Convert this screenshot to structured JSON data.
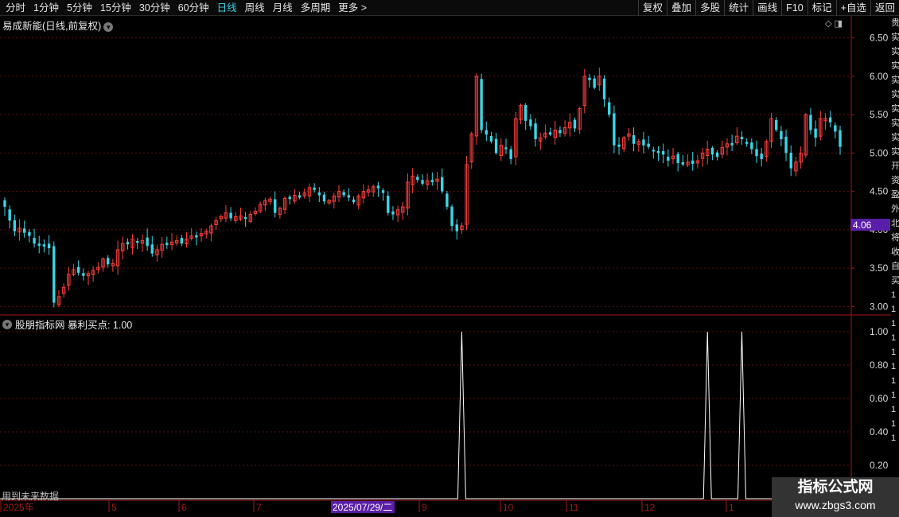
{
  "toolbar": {
    "periods": [
      {
        "label": "分时",
        "active": false
      },
      {
        "label": "1分钟",
        "active": false
      },
      {
        "label": "5分钟",
        "active": false
      },
      {
        "label": "15分钟",
        "active": false
      },
      {
        "label": "30分钟",
        "active": false
      },
      {
        "label": "60分钟",
        "active": false
      },
      {
        "label": "日线",
        "active": true
      },
      {
        "label": "周线",
        "active": false
      },
      {
        "label": "月线",
        "active": false
      },
      {
        "label": "多周期",
        "active": false
      },
      {
        "label": "更多",
        "active": false
      }
    ],
    "more_arrow": ">",
    "buttons": [
      "复权",
      "叠加",
      "多股",
      "统计",
      "画线",
      "F10",
      "标记",
      "+自选",
      "返回"
    ]
  },
  "stock": {
    "title": "易成新能(日线,前复权)",
    "dropdown_icon": "chevron-down-icon"
  },
  "price_axis": {
    "ticks": [
      "6.50",
      "6.00",
      "5.50",
      "5.00",
      "4.50",
      "4.00",
      "3.50",
      "3.00"
    ],
    "current_price": "4.06"
  },
  "indicator": {
    "title": "股朋指标网 暴利买点: 1.00",
    "axis_ticks": [
      "1.00",
      "0.80",
      "0.60",
      "0.40",
      "0.20"
    ],
    "signal_index": [
      93,
      143,
      150
    ],
    "future_data_label": "用到未来数据"
  },
  "date_axis": {
    "labels": [
      "2025年",
      "5",
      "6",
      "7",
      "2025/07/29/二",
      "9",
      "10",
      "11",
      "12",
      "1"
    ],
    "highlight_label": "2025/07/29/二"
  },
  "right_strip": [
    "贵",
    "实",
    "实",
    "实",
    "实",
    "实",
    "实",
    "实",
    "实",
    "实",
    "开",
    "资",
    "盈",
    "外",
    "北",
    "将",
    "收",
    "自",
    "买",
    "1",
    "1",
    "1",
    "1",
    "1",
    "1",
    "1",
    "1",
    "1",
    "1",
    "1"
  ],
  "watermark": {
    "line1": "指标公式网",
    "line2": "www.zbgs3.com"
  },
  "colors": {
    "up": "#ff3e3e",
    "down": "#3ad6e6",
    "grid": "#5a0f0f",
    "axis": "#a01818",
    "price_label_bg": "#5a1ea8",
    "date_label_bg": "#5a1ea8",
    "toolbar_active": "#3ad0e8",
    "signal_line": "#ffffff"
  },
  "chart_data": {
    "type": "candlestick",
    "title": "易成新能(日线,前复权)",
    "ylim": [
      2.9,
      6.6
    ],
    "closes": [
      4.3,
      4.12,
      3.98,
      4.02,
      3.96,
      3.92,
      3.82,
      3.79,
      3.78,
      3.76,
      3.05,
      3.13,
      3.25,
      3.42,
      3.48,
      3.44,
      3.4,
      3.43,
      3.47,
      3.51,
      3.62,
      3.55,
      3.56,
      3.74,
      3.82,
      3.81,
      3.88,
      3.83,
      3.86,
      3.79,
      3.69,
      3.74,
      3.81,
      3.8,
      3.84,
      3.86,
      3.82,
      3.88,
      3.92,
      3.9,
      3.95,
      3.98,
      4.05,
      4.12,
      4.17,
      4.22,
      4.15,
      4.17,
      4.18,
      4.14,
      4.2,
      4.24,
      4.33,
      4.38,
      4.4,
      4.22,
      4.28,
      4.41,
      4.4,
      4.45,
      4.42,
      4.48,
      4.55,
      4.52,
      4.45,
      4.37,
      4.38,
      4.44,
      4.5,
      4.45,
      4.42,
      4.36,
      4.44,
      4.5,
      4.52,
      4.56,
      4.54,
      4.48,
      4.22,
      4.2,
      4.26,
      4.3,
      4.62,
      4.7,
      4.65,
      4.6,
      4.64,
      4.62,
      4.66,
      4.5,
      4.3,
      4.05,
      3.98,
      4.05,
      4.85,
      5.25,
      6.0,
      5.3,
      5.24,
      5.15,
      5.0,
      5.1,
      5.05,
      4.92,
      5.45,
      5.62,
      5.42,
      5.35,
      5.18,
      5.2,
      5.26,
      5.24,
      5.3,
      5.26,
      5.33,
      5.4,
      5.32,
      5.58,
      6.0,
      5.95,
      5.85,
      6.0,
      5.7,
      5.5,
      5.1,
      5.08,
      5.2,
      5.25,
      5.12,
      5.15,
      5.1,
      5.08,
      5.02,
      5.0,
      4.98,
      4.9,
      4.96,
      4.87,
      4.85,
      4.88,
      4.86,
      4.9,
      5.0,
      5.05,
      4.98,
      4.95,
      5.07,
      5.12,
      5.1,
      5.22,
      5.18,
      5.12,
      5.05,
      4.96,
      4.92,
      5.15,
      5.45,
      5.3,
      5.18,
      5.0,
      4.8,
      4.88,
      5.0,
      5.5,
      5.3,
      5.2,
      5.45,
      5.45,
      5.4,
      5.28,
      5.08
    ]
  }
}
